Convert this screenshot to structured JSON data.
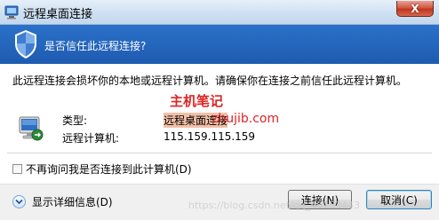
{
  "window": {
    "title": "远程桌面连接",
    "close_glyph": "X",
    "app_icon": "remote-desktop-icon"
  },
  "header": {
    "question": "是否信任此远程连接?",
    "icon": "shield-icon",
    "band_color": "#1e5bb0"
  },
  "body": {
    "warning": "此远程连接会损坏你的本地或远程计算机。请确保你在连接之前信任此远程计算机。",
    "type_label": "类型:",
    "type_value": "远程桌面连接",
    "computer_label": "远程计算机:",
    "computer_value": "115.159.115.159",
    "icon": "computer-network-icon"
  },
  "watermarks": {
    "line1": "主机笔记",
    "line2": "zhujib.com",
    "line3": "https://blog.csdn.net/qq_46163443"
  },
  "options": {
    "dont_ask_label": "不再询问我是否连接到此计算机(D)",
    "dont_ask_checked": false
  },
  "footer": {
    "details_label": "显示详细信息(D)",
    "connect_label": "连接(N)",
    "cancel_label": "取消(C)"
  }
}
